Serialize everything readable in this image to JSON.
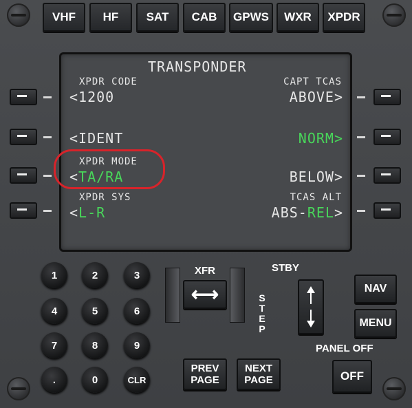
{
  "top_buttons": [
    "VHF",
    "HF",
    "SAT",
    "CAB",
    "GPWS",
    "WXR",
    "XPDR"
  ],
  "screen": {
    "title": "TRANSPONDER",
    "l1_label": "XPDR CODE",
    "l1_value": "<1200",
    "r1_label": "CAPT TCAS",
    "r1_value": "ABOVE>",
    "l2_value": "<IDENT",
    "r2_value": "NORM>",
    "l3_label": "XPDR MODE",
    "l3_arrow": "<",
    "l3_value": "TA/RA",
    "r3_value": "BELOW>",
    "l4_label": "XPDR SYS",
    "l4_arrow": "<",
    "l4_value": "L-R",
    "r4_label": "TCAS ALT",
    "r4_value_a": "ABS-",
    "r4_value_b": "REL",
    "r4_value_c": ">"
  },
  "keypad": [
    "1",
    "2",
    "3",
    "4",
    "5",
    "6",
    "7",
    "8",
    "9",
    ".",
    "0",
    "CLR"
  ],
  "xfr_label": "XFR",
  "xfr_glyph": "⟷",
  "stby_label": "STBY",
  "step_label": "STEP",
  "nav_label": "NAV",
  "menu_label": "MENU",
  "prev_page_label": "PREV PAGE",
  "next_page_label": "NEXT PAGE",
  "panel_off_label": "PANEL OFF",
  "off_label": "OFF",
  "highlight_color": "#d8232a",
  "active_text_color": "#48d65a"
}
